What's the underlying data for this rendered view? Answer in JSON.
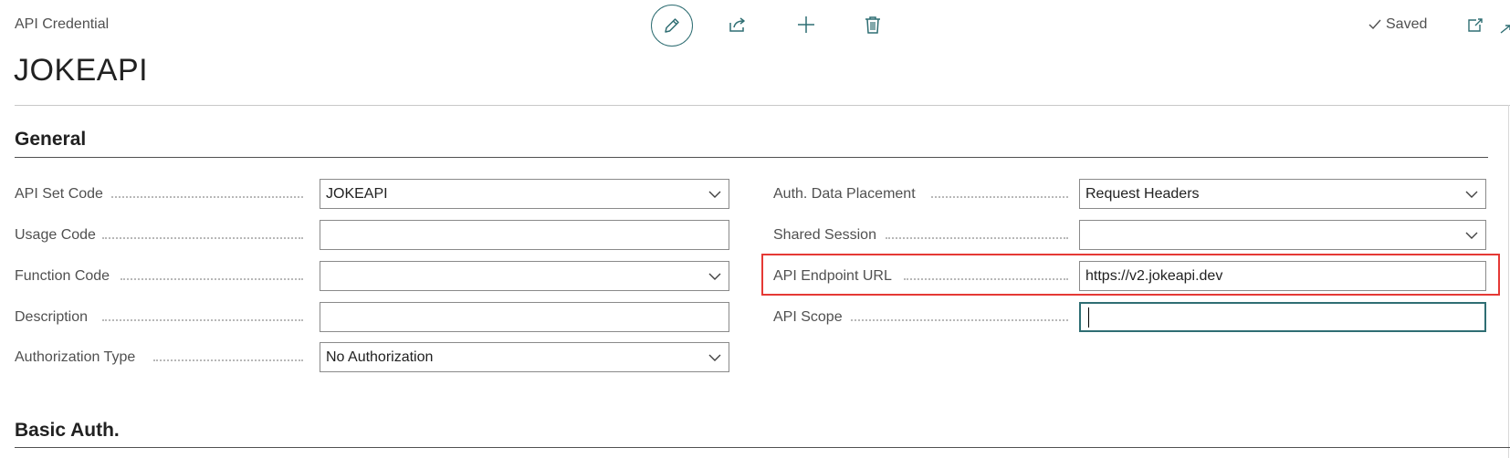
{
  "header": {
    "breadcrumb": "API Credential",
    "title": "JOKEAPI",
    "saved_label": "Saved",
    "actions": [
      {
        "name": "edit",
        "icon": "pencil-icon"
      },
      {
        "name": "share",
        "icon": "share-icon"
      },
      {
        "name": "new",
        "icon": "plus-icon"
      },
      {
        "name": "delete",
        "icon": "trash-icon"
      }
    ]
  },
  "sections": {
    "general": "General",
    "basic_auth": "Basic Auth."
  },
  "general": {
    "left": [
      {
        "label": "API Set Code",
        "value": "JOKEAPI",
        "dropdown": true
      },
      {
        "label": "Usage Code",
        "value": "",
        "dropdown": false
      },
      {
        "label": "Function Code",
        "value": "",
        "dropdown": true
      },
      {
        "label": "Description",
        "value": "",
        "dropdown": false
      },
      {
        "label": "Authorization Type",
        "value": "No Authorization",
        "dropdown": true
      }
    ],
    "right": [
      {
        "label": "Auth. Data Placement",
        "value": "Request Headers",
        "dropdown": true
      },
      {
        "label": "Shared Session",
        "value": "",
        "dropdown": true
      },
      {
        "label": "API Endpoint URL",
        "value": "https://v2.jokeapi.dev",
        "dropdown": false
      },
      {
        "label": "API Scope",
        "value": "",
        "dropdown": false,
        "focused": true
      }
    ]
  },
  "colors": {
    "accent": "#2f6e73",
    "highlight": "#e53935",
    "label": "#505050"
  }
}
